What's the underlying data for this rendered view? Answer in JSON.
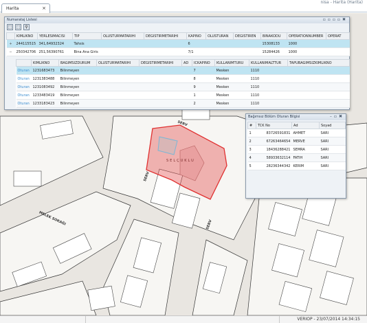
{
  "tab": {
    "label": "Harita",
    "close": "×"
  },
  "user_info": "nisa - Harita (Harita)",
  "map": {
    "road_labels": [
      "SERV",
      "SERV",
      "SERV",
      "MELEK SOKAĞI",
      "SERV"
    ],
    "parcel_label": "SELÇUKLU",
    "highlight_color": "#e03030"
  },
  "numarataj": {
    "title": "Numarataj Listesi",
    "parcel_headers": [
      "",
      "KIMLIKNO",
      "YERLESIMACISI",
      "TIP",
      "OLUSTURMATARIHI",
      "DEGISTIRMETARIHI",
      "KAPINO",
      "OLUSTURAN",
      "DEGISTIREN",
      "BINAKODU",
      "OPERATIONNUMBER",
      "OPERAT"
    ],
    "parcel_rows": [
      {
        "expander": "+",
        "kimlikno": "244115515",
        "yerlesim": "341,64932324",
        "tip": "Tahsis",
        "olus": "",
        "degis": "",
        "kapino": "6",
        "olusturan": "",
        "degistiren": "",
        "binakodu": "15308133",
        "opnum": "1000",
        "op": ""
      },
      {
        "expander": "−",
        "kimlikno": "250342706",
        "yerlesim": "251,56390761",
        "tip": "Bina Ana Giris",
        "olus": "",
        "degis": "",
        "kapino": "7/1",
        "olusturan": "",
        "degistiren": "",
        "binakodu": "15284426",
        "opnum": "1000",
        "op": ""
      }
    ],
    "unit_headers": [
      "",
      "KIMLIKNO",
      "BAGIMSIZDURUM",
      "OLUSTURMATARIHI",
      "DEGISTIRMETARIHI",
      "AD",
      "ICKAPINO",
      "KULLANIMTURU",
      "KULLANIMALTTUR",
      "TAPUBAGIMSIZKIMLIKNO"
    ],
    "unit_rows": [
      {
        "link": "Oturan",
        "kimlikno": "1231683473",
        "durum": "Bilinmeyen",
        "olus": "",
        "degis": "",
        "ad": "",
        "ickapino": "7",
        "tur": "Mesken",
        "alttur": "1110",
        "tapu": ""
      },
      {
        "link": "Oturan",
        "kimlikno": "1231383488",
        "durum": "Bilinmeyen",
        "olus": "",
        "degis": "",
        "ad": "",
        "ickapino": "8",
        "tur": "Mesken",
        "alttur": "1110",
        "tapu": ""
      },
      {
        "link": "Oturan",
        "kimlikno": "1231083492",
        "durum": "Bilinmeyen",
        "olus": "",
        "degis": "",
        "ad": "",
        "ickapino": "9",
        "tur": "Mesken",
        "alttur": "1110",
        "tapu": ""
      },
      {
        "link": "Oturan",
        "kimlikno": "1233483419",
        "durum": "Bilinmeyen",
        "olus": "",
        "degis": "",
        "ad": "",
        "ickapino": "1",
        "tur": "Mesken",
        "alttur": "1110",
        "tapu": ""
      },
      {
        "link": "Oturan",
        "kimlikno": "1233183423",
        "durum": "Bilinmeyen",
        "olus": "",
        "degis": "",
        "ad": "",
        "ickapino": "2",
        "tur": "Mesken",
        "alttur": "1110",
        "tapu": ""
      }
    ]
  },
  "oturan": {
    "title": "Bağımsız Bölüm Oturan Bilgisi",
    "headers": [
      "#",
      "TCK No",
      "Ad",
      "Soyad"
    ],
    "rows": [
      {
        "no": "1",
        "tck": "83726591831",
        "ad": "AHMET",
        "soyad": "SARI"
      },
      {
        "no": "2",
        "tck": "67263464654",
        "ad": "MERVE",
        "soyad": "SARI"
      },
      {
        "no": "3",
        "tck": "18436288421",
        "ad": "SEMRA",
        "soyad": "SARI"
      },
      {
        "no": "4",
        "tck": "58933632114",
        "ad": "FATIH",
        "soyad": "SARI"
      },
      {
        "no": "5",
        "tck": "28236344342",
        "ad": "KERIM",
        "soyad": "SARI"
      }
    ]
  },
  "status": {
    "version": "VERIOP - 23/07/2014 14:34:15"
  }
}
